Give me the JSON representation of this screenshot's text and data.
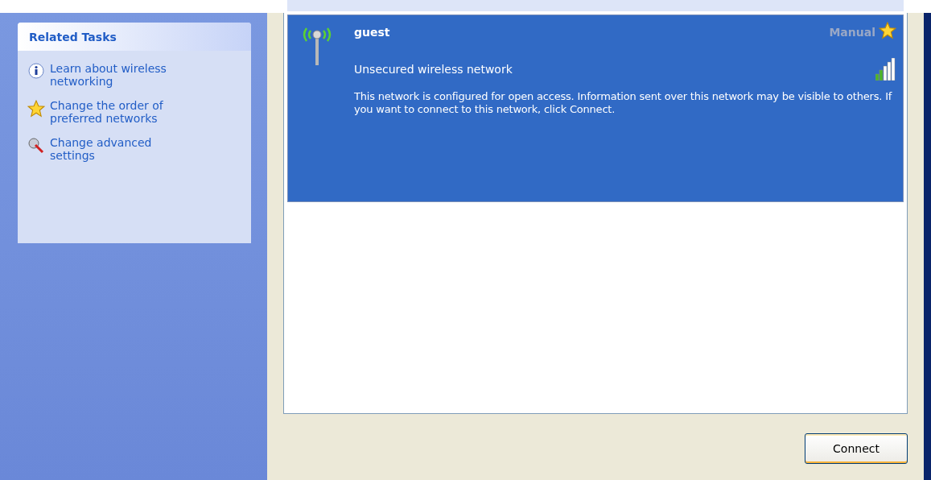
{
  "related_tasks": {
    "title": "Related Tasks",
    "items": [
      {
        "kind": "info",
        "label": "Learn about wireless networking"
      },
      {
        "kind": "star",
        "label": "Change the order of preferred networks"
      },
      {
        "kind": "tools",
        "label": "Change advanced settings"
      }
    ]
  },
  "networks": [
    {
      "name": "guest",
      "connection": "Manual",
      "preferred": true,
      "security": "Unsecured wireless network",
      "description": "This network is configured for open access. Information sent over this network may be visible to others. If you want to connect to this network, click Connect.",
      "selected": true
    }
  ],
  "buttons": [
    {
      "label": "Connect"
    }
  ]
}
